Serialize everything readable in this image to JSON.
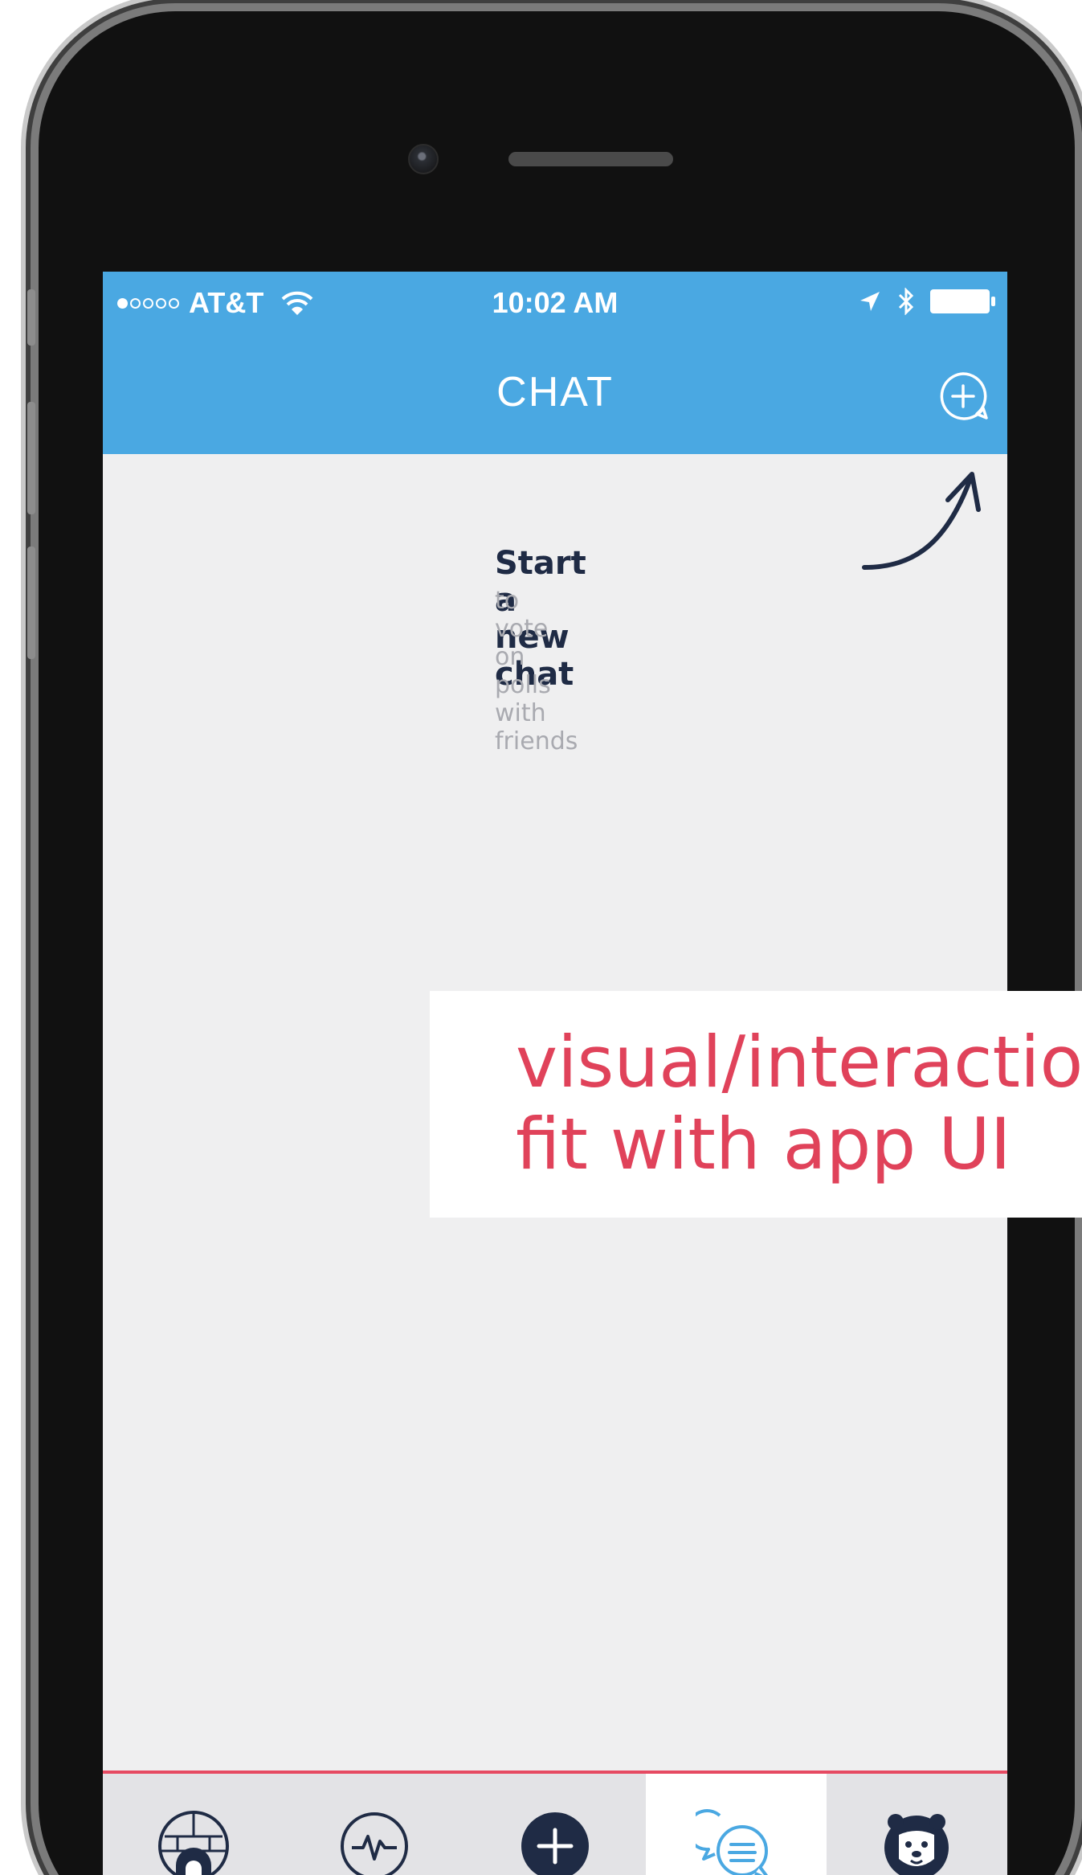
{
  "status_bar": {
    "carrier": "AT&T",
    "time": "10:02 AM",
    "signal_icon": "signal-dots-icon",
    "wifi_icon": "wifi-icon",
    "location_icon": "location-arrow-icon",
    "bluetooth_icon": "bluetooth-icon",
    "battery_icon": "battery-icon"
  },
  "nav": {
    "title": "CHAT",
    "action_icon": "add-chat-icon"
  },
  "empty_state": {
    "title": "Start a new chat",
    "subtitle": "to vote on polls with friends",
    "arrow_icon": "curved-arrow-icon"
  },
  "overlay": {
    "line1": "visual/interaction",
    "line2": "fit with app UI"
  },
  "tabs": [
    {
      "name": "igloo-icon",
      "active": false
    },
    {
      "name": "activity-icon",
      "active": false
    },
    {
      "name": "add-icon",
      "active": false
    },
    {
      "name": "chat-icon",
      "active": true
    },
    {
      "name": "bear-icon",
      "active": false
    }
  ],
  "colors": {
    "header": "#4aa8e2",
    "accent_red": "#e64a62",
    "overlay_text": "#e0425a",
    "navy": "#1f2b45"
  }
}
